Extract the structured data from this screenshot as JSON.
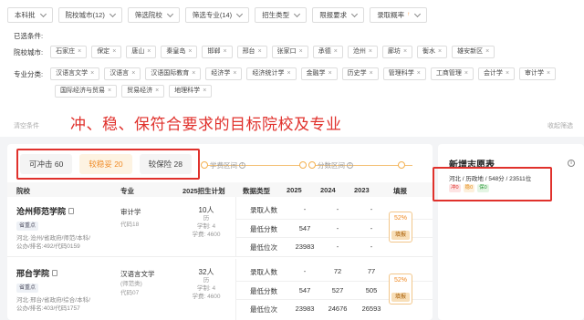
{
  "filter_bar": {
    "items": [
      {
        "label": "本科批"
      },
      {
        "label": "院校城市(12)"
      },
      {
        "label": "筛选院校"
      },
      {
        "label": "筛选专业(14)"
      },
      {
        "label": "招生类型"
      },
      {
        "label": "限报要求"
      },
      {
        "label": "录取概率",
        "badge": "↑"
      }
    ]
  },
  "selected": {
    "label": "已选条件:",
    "cities_label": "院校城市:",
    "cities": [
      "石家庄",
      "保定",
      "唐山",
      "秦皇岛",
      "邯郸",
      "邢台",
      "张家口",
      "承德",
      "沧州",
      "廊坊",
      "衡水",
      "雄安新区"
    ],
    "majors_label": "专业分类:",
    "majors_row1": [
      "汉语言文学",
      "汉语言",
      "汉语国际教育",
      "经济学",
      "经济统计学",
      "金融学",
      "历史学",
      "管理科学",
      "工商管理",
      "会计学",
      "审计学"
    ],
    "majors_row2": [
      "国际经济与贸易",
      "贸易经济",
      "地理科学"
    ],
    "clear_left": "清空条件",
    "clear_right": "收起筛选"
  },
  "annotation": "冲、稳、保符合要求的目标院校及专业",
  "tabs": [
    {
      "label": "可冲击 60",
      "active": false
    },
    {
      "label": "较稳妥 20",
      "active": true
    },
    {
      "label": "较保险 28",
      "active": false
    }
  ],
  "ranges": {
    "tuition": "学费区间",
    "score": "分数区间"
  },
  "table": {
    "headers": [
      "院校",
      "专业",
      "2025招生计划",
      "数据类型",
      "2025",
      "2024",
      "2023",
      "填报"
    ],
    "rows": [
      {
        "school": "沧州师范学院",
        "badge": "省重点",
        "meta1": "河北·沧州/省政府/师范/本科/",
        "meta2": "公办/排名:492/代码0159",
        "major": "审计学",
        "major_code": "代码18",
        "plan": "10人",
        "plan_type": "历",
        "plan_years": "学制: 4",
        "plan_fee": "学费: 4600",
        "stats": [
          {
            "label": "录取人数",
            "v2025": "-",
            "v2024": "-",
            "v2023": "-"
          },
          {
            "label": "最低分数",
            "v2025": "547",
            "v2024": "-",
            "v2023": "-"
          },
          {
            "label": "最低位次",
            "v2025": "23983",
            "v2024": "-",
            "v2023": "-"
          }
        ],
        "pct": "52%",
        "fill_label": "填报"
      },
      {
        "school": "邢台学院",
        "badge": "省重点",
        "meta1": "河北·邢台/省政府/综合/本科/",
        "meta2": "公办/排名:403/代码1757",
        "major": "汉语言文学",
        "major_code": "(师范类)",
        "major_code2": "代码07",
        "plan": "32人",
        "plan_type": "历",
        "plan_years": "学制: 4",
        "plan_fee": "学费: 4600",
        "stats": [
          {
            "label": "录取人数",
            "v2025": "-",
            "v2024": "72",
            "v2023": "77"
          },
          {
            "label": "最低分数",
            "v2025": "547",
            "v2024": "527",
            "v2023": "505"
          },
          {
            "label": "最低位次",
            "v2025": "23983",
            "v2024": "24676",
            "v2023": "26593"
          }
        ],
        "pct": "52%",
        "fill_label": "填报"
      }
    ]
  },
  "side": {
    "title": "新增志愿表",
    "profile": "河北 / 历政地 / 548分 / 23511位",
    "badges": [
      "冲0",
      "稳0",
      "保0"
    ]
  },
  "colors": {
    "accent": "#f08a24",
    "annotation_red": "#e0312c"
  }
}
